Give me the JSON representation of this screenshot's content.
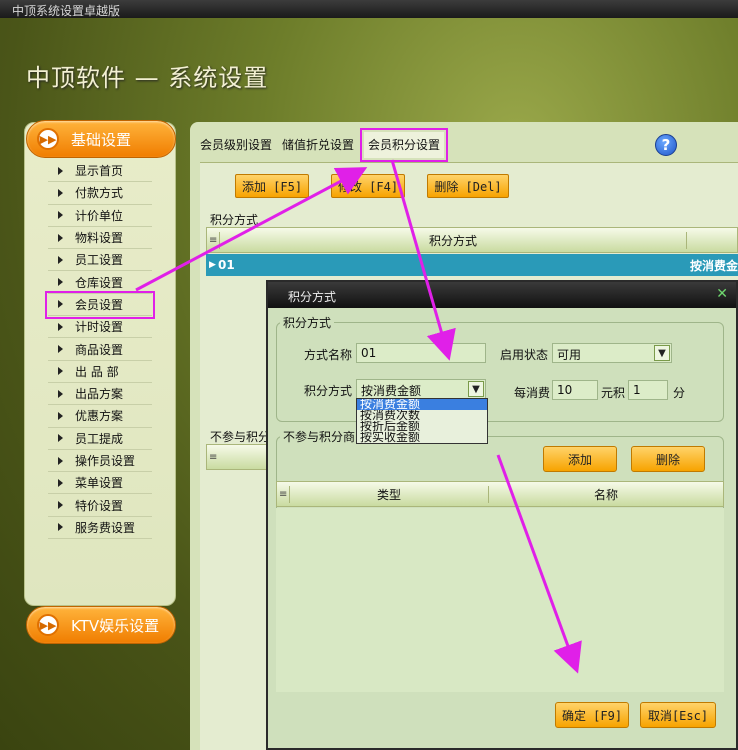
{
  "window": {
    "title": "中顶系统设置卓越版"
  },
  "app": {
    "brand": "中顶软件",
    "sep": " — ",
    "title": "系统设置"
  },
  "sidebar": {
    "section1": "基础设置",
    "section2": "KTV娱乐设置",
    "items": [
      "显示首页",
      "付款方式",
      "计价单位",
      "物料设置",
      "员工设置",
      "仓库设置",
      "会员设置",
      "计时设置",
      "商品设置",
      "出 品 部",
      "出品方案",
      "优惠方案",
      "员工提成",
      "操作员设置",
      "菜单设置",
      "特价设置",
      "服务费设置"
    ]
  },
  "tabs": [
    "会员级别设置",
    "储值折兑设置",
    "会员积分设置"
  ],
  "toolbar": {
    "add": "添加 [F5]",
    "edit": "修改 [F4]",
    "delete": "删除 [Del]"
  },
  "group1": {
    "label": "积分方式",
    "column": "积分方式",
    "row_id": "01",
    "row_value": "按消费金"
  },
  "group2": {
    "label": "不参与积分"
  },
  "dialog": {
    "title": "积分方式",
    "legend": "积分方式",
    "name_label": "方式名称",
    "name_value": "01",
    "status_label": "启用状态",
    "status_value": "可用",
    "method_label": "积分方式",
    "method_value": "按消费金额",
    "per_label": "每消费",
    "per_value": "10",
    "yuan_label": "元积",
    "points_value": "1",
    "fen_label": "分",
    "options": [
      "按消费金额",
      "按消费次数",
      "按折后金额",
      "按实收金额"
    ],
    "exclude_legend": "不参与积分商品",
    "add_btn": "添加",
    "del_btn": "删除",
    "col_type": "类型",
    "col_name": "名称",
    "ok_btn": "确定 [F9]",
    "cancel_btn": "取消[Esc]"
  },
  "colors": {
    "highlight": "#e020e8",
    "orange": "#f7a300",
    "row_blue": "#2a9ab8"
  }
}
